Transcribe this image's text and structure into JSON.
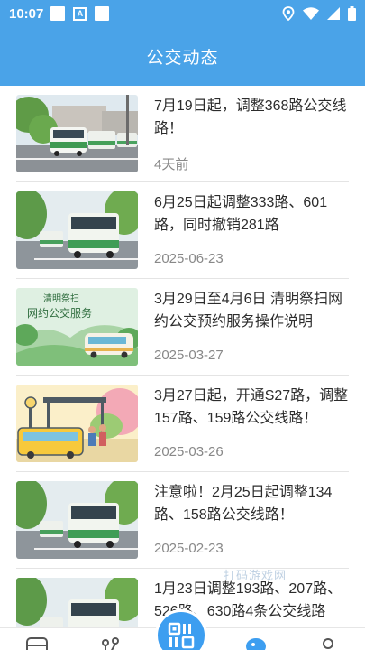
{
  "status_bar": {
    "time": "10:07",
    "a_label": "A"
  },
  "header": {
    "title": "公交动态"
  },
  "news": [
    {
      "title": "7月19日起，调整368路公交线路！",
      "date": "4天前"
    },
    {
      "title": "6月25日起调整333路、601路，同时撤销281路",
      "date": "2025-06-23"
    },
    {
      "title": " 3月29日至4月6日 清明祭扫网约公交预约服务操作说明",
      "date": "2025-03-27"
    },
    {
      "title": "3月27日起，开通S27路，调整157路、159路公交线路！",
      "date": "2025-03-26"
    },
    {
      "title": " 注意啦！2月25日起调整134路、158路公交线路！",
      "date": "2025-02-23"
    },
    {
      "title": "1月23日调整193路、207路、526路、630路4条公交线路",
      "date": ""
    }
  ],
  "thumb_texts": {
    "qingming_line1": "清明祭扫",
    "qingming_line2": "网约公交服务"
  },
  "watermark": "打码游戏网",
  "colors": {
    "header": "#4aa3e8",
    "accent": "#3d9ef0"
  },
  "bottom_nav": {
    "icons": [
      "bus-icon",
      "route-icon",
      "scan-icon",
      "news-icon",
      "profile-icon"
    ]
  }
}
